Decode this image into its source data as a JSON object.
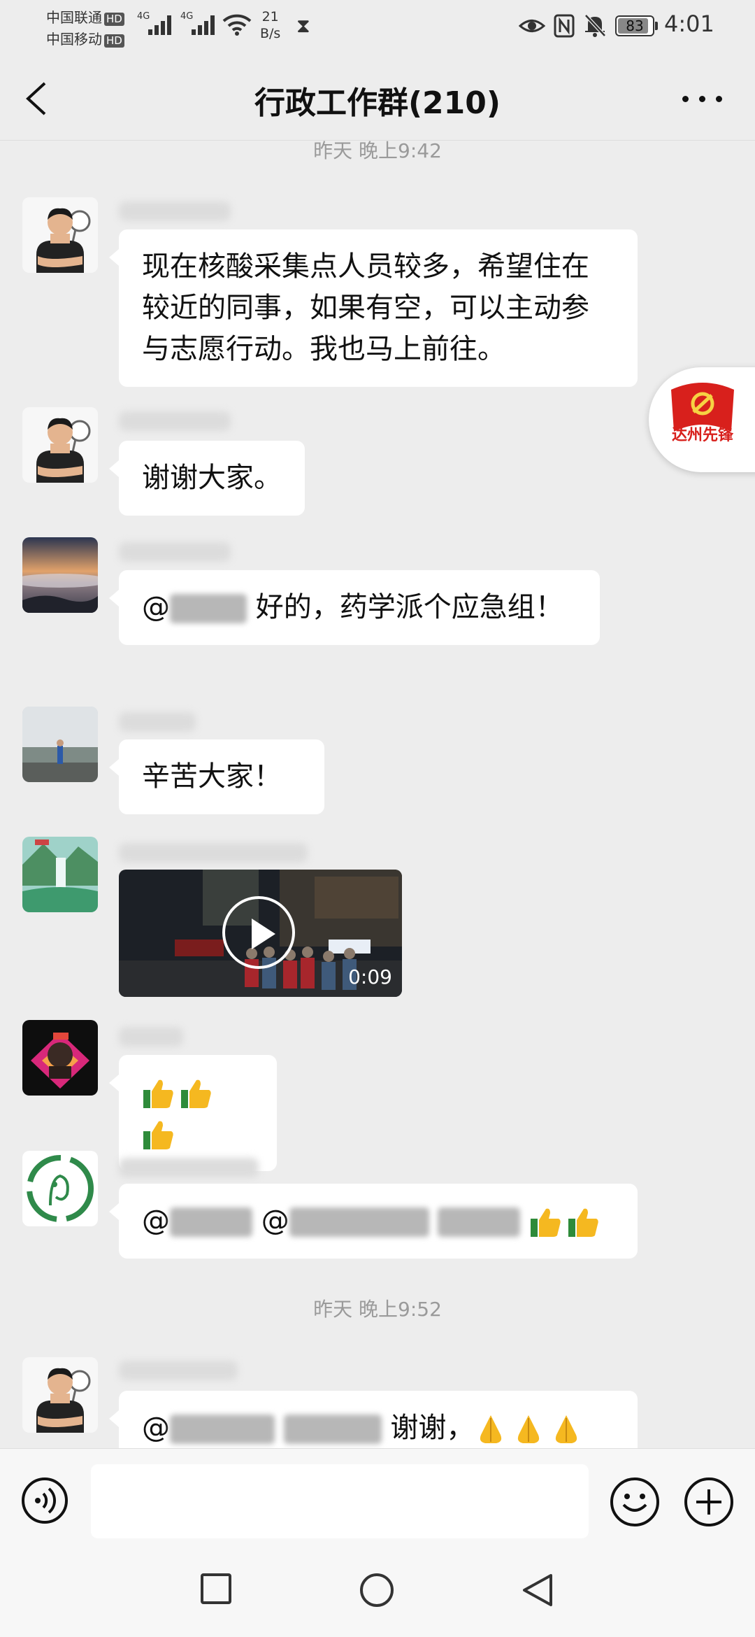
{
  "status_bar": {
    "carrier1": "中国联通",
    "carrier2": "中国移动",
    "hd_label": "HD",
    "signal_label": "4G",
    "speed_value": "21",
    "speed_unit": "B/s",
    "battery": "83",
    "time": "4:01"
  },
  "header": {
    "title": "行政工作群(210)"
  },
  "chat": {
    "timestamp_top": "昨天 晚上9:42",
    "messages": [
      {
        "text": "现在核酸采集点人员较多，希望住在较近的同事，如果有空，可以主动参与志愿行动。我也马上前往。"
      },
      {
        "text": "谢谢大家。"
      },
      {
        "prefix": "@",
        "suffix": " 好的，药学派个应急组！"
      },
      {
        "text": "辛苦大家！"
      },
      {
        "video_duration": "0:09"
      },
      {
        "emoji": "thumbs-up x3"
      },
      {
        "prefix": "@",
        "mid": "@",
        "emoji": "thumbs-up x2"
      },
      {
        "prefix": "@",
        "suffix": " 谢谢，",
        "emoji": "folded-hands x3"
      }
    ],
    "timestamp_bottom": "昨天 晚上9:52",
    "floating_badge_text": "达州先锋"
  },
  "input": {
    "placeholder": ""
  },
  "colors": {
    "background": "#ededed",
    "bubble": "#ffffff",
    "timestamp": "#9a9a9a"
  }
}
